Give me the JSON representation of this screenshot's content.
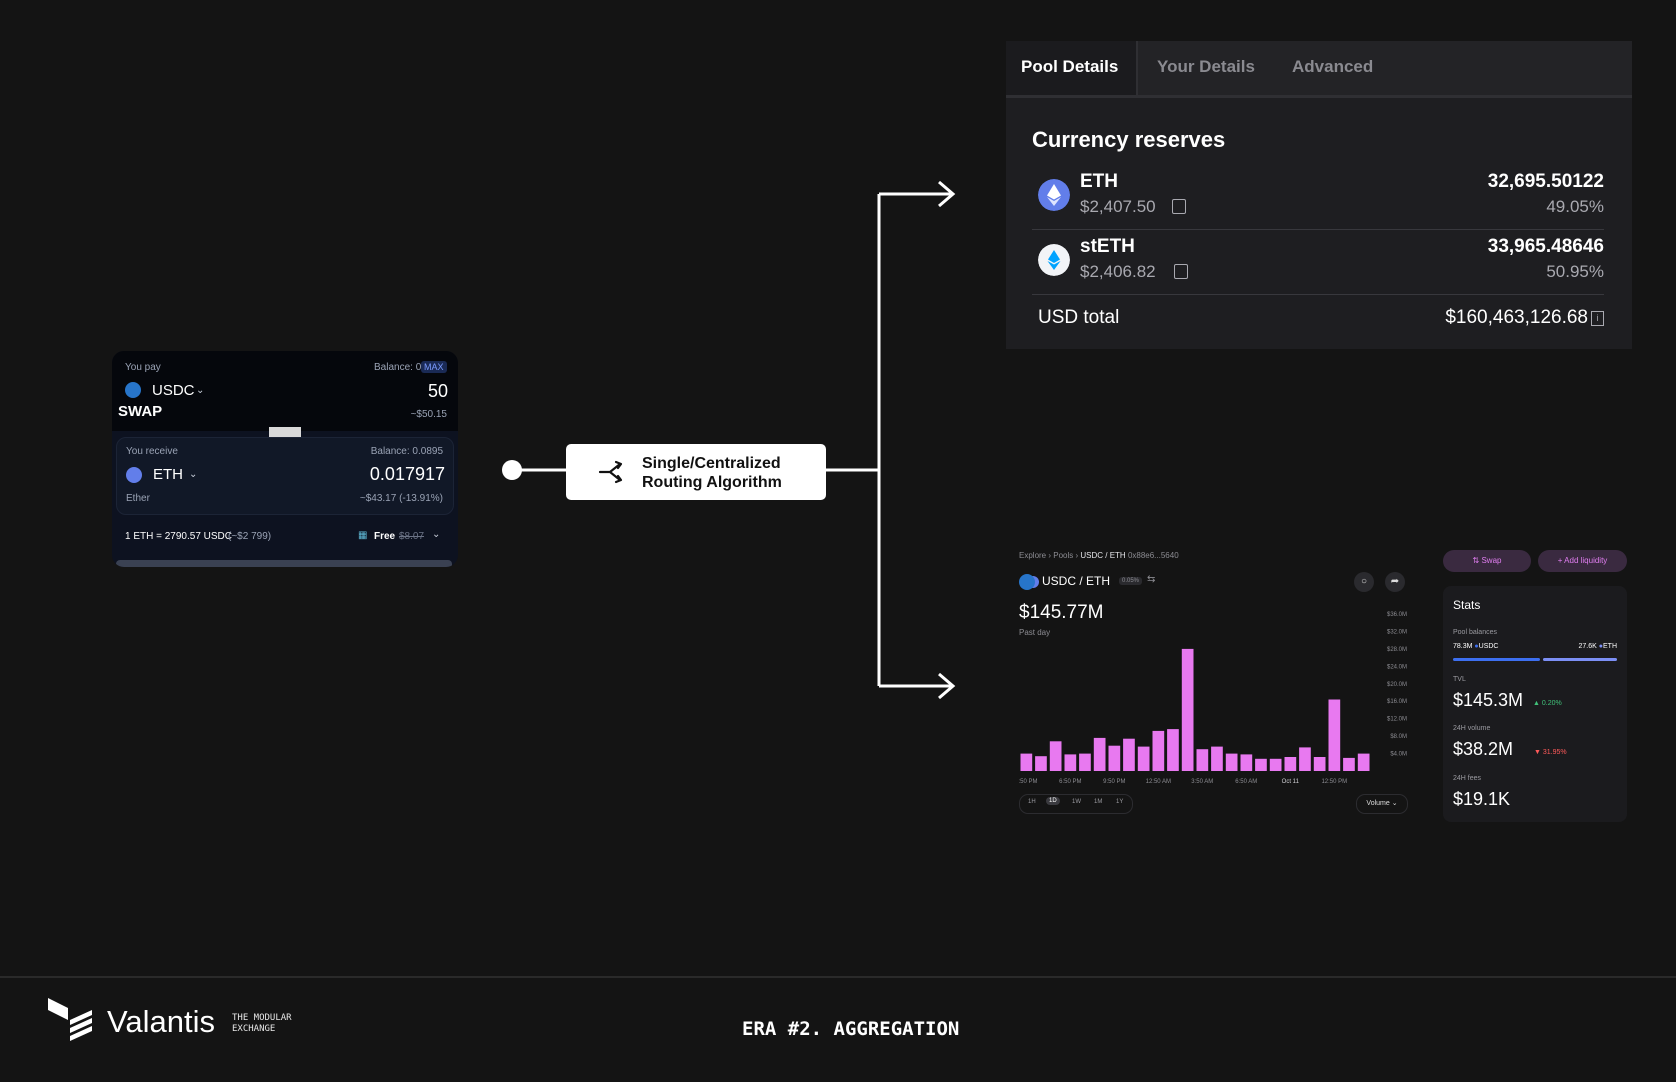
{
  "swap_widget": {
    "pay_label": "You pay",
    "pay_balance": "Balance: 0",
    "max_label": "MAX",
    "pay_token": "USDC",
    "pay_amount": "50",
    "pay_usd": "~$50.15",
    "swap_label": "SWAP",
    "receive_label": "You receive",
    "receive_balance": "Balance: 0.0895",
    "receive_token": "ETH",
    "receive_token_full": "Ether",
    "receive_amount": "0.017917",
    "receive_usd": "~$43.17  (-13.91%)",
    "rate_text": "1 ETH =  2790.57 USDC",
    "rate_usd": "(~$2 799)",
    "fee_free": "Free",
    "fee_old": "$8.07"
  },
  "routing": {
    "line1": "Single/Centralized",
    "line2": "Routing Algorithm"
  },
  "pool_details": {
    "tabs": [
      "Pool Details",
      "Your Details",
      "Advanced"
    ],
    "section_title": "Currency reserves",
    "reserves": [
      {
        "symbol": "ETH",
        "price": "$2,407.50",
        "amount": "32,695.50122",
        "percent": "49.05%"
      },
      {
        "symbol": "stETH",
        "price": "$2,406.82",
        "amount": "33,965.48646",
        "percent": "50.95%"
      }
    ],
    "usd_total_label": "USD total",
    "usd_total_value": "$160,463,126.68"
  },
  "analytics": {
    "breadcrumb": [
      "Explore",
      "Pools",
      "USDC / ETH"
    ],
    "address": "0x88e6...5640",
    "pair": "USDC / ETH",
    "fee_badge": "0.05%",
    "headline_value": "$145.77M",
    "headline_period": "Past day",
    "range_options": [
      "1H",
      "1D",
      "1W",
      "1M",
      "1Y"
    ],
    "range_selected": "1D",
    "metric_select": "Volume",
    "swap_button": "Swap",
    "add_liquidity_button": "Add liquidity",
    "stats": {
      "title": "Stats",
      "pool_balances_label": "Pool balances",
      "balance_usdc": "78.3M",
      "balance_usdc_symbol": "USDC",
      "balance_eth": "27.6K",
      "balance_eth_symbol": "ETH",
      "tvl_label": "TVL",
      "tvl_value": "$145.3M",
      "tvl_delta": "0.20%",
      "volume_label": "24H volume",
      "volume_value": "$38.2M",
      "volume_delta": "31.95%",
      "fees_label": "24H fees",
      "fees_value": "$19.1K"
    }
  },
  "chart_data": {
    "type": "bar",
    "series_color": "#e879f0",
    "categories": [
      "3:50 PM",
      "",
      "",
      "6:50 PM",
      "",
      "",
      "9:50 PM",
      "",
      "",
      "12:50 AM",
      "",
      "",
      "3:50 AM",
      "",
      "",
      "6:50 AM",
      "",
      "",
      "Oct 11",
      "",
      "",
      "12:50 PM",
      "",
      "",
      ""
    ],
    "values": [
      4.0,
      3.4,
      6.8,
      3.8,
      4.0,
      7.6,
      5.8,
      7.4,
      5.6,
      9.2,
      9.6,
      28.0,
      5.0,
      5.6,
      4.0,
      3.8,
      2.8,
      2.8,
      3.2,
      5.4,
      3.2,
      16.4,
      3.0,
      4.0
    ],
    "x_tick_labels": [
      "3:50 PM",
      "6:50 PM",
      "9:50 PM",
      "12:50 AM",
      "3:50 AM",
      "6:50 AM",
      "Oct 11",
      "12:50 PM"
    ],
    "y_tick_labels": [
      "$36.0M",
      "$32.0M",
      "$28.0M",
      "$24.0M",
      "$20.0M",
      "$16.0M",
      "$12.0M",
      "$8.0M",
      "$4.0M"
    ],
    "ylim": [
      0,
      36
    ]
  },
  "footer": {
    "brand": "Valantis",
    "tagline_line1": "THE MODULAR",
    "tagline_line2": "EXCHANGE",
    "era": "ERA #2. AGGREGATION"
  }
}
